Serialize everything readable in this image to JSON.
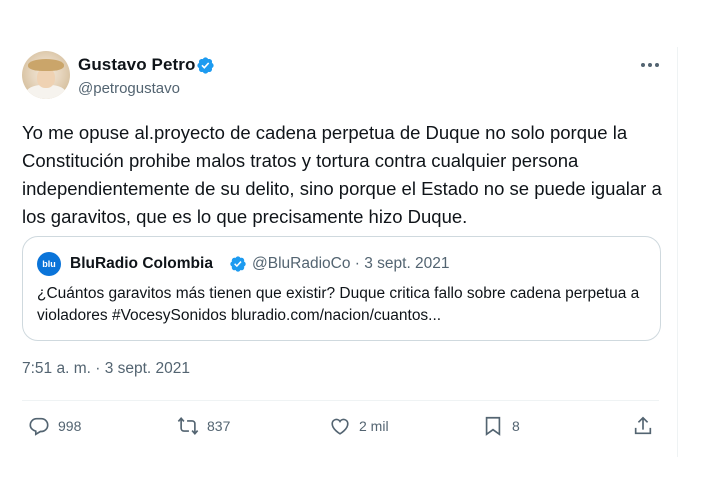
{
  "tweet": {
    "author_name": "Gustavo Petro",
    "author_handle": "@petrogustavo",
    "text": "Yo me opuse al.proyecto de cadena perpetua de Duque no solo porque la Constitución prohibe malos tratos y tortura contra cualquier persona independientemente de su delito, sino porque el Estado no se puede igualar a los garavitos, que es lo que precisamente hizo Duque.",
    "timestamp": "7:51 a. m. · 3 sept. 2021"
  },
  "quote": {
    "logo_text": "blu",
    "author_name": "BluRadio Colombia",
    "meta": "@BluRadioCo · 3 sept. 2021",
    "text": "¿Cuántos garavitos más tienen que existir? Duque critica fallo sobre cadena perpetua a violadores #VocesySonidos bluradio.com/nacion/cuantos..."
  },
  "actions": {
    "replies": "998",
    "retweets": "837",
    "likes": "2 mil",
    "bookmarks": "8"
  },
  "icons": [
    "verified-badge-icon",
    "more-icon",
    "reply-icon",
    "retweet-icon",
    "like-icon",
    "bookmark-icon",
    "share-icon"
  ],
  "colors": {
    "verified": "#1d9bf0",
    "secondary_text": "#536471",
    "brand_blu": "#0a74d9"
  }
}
